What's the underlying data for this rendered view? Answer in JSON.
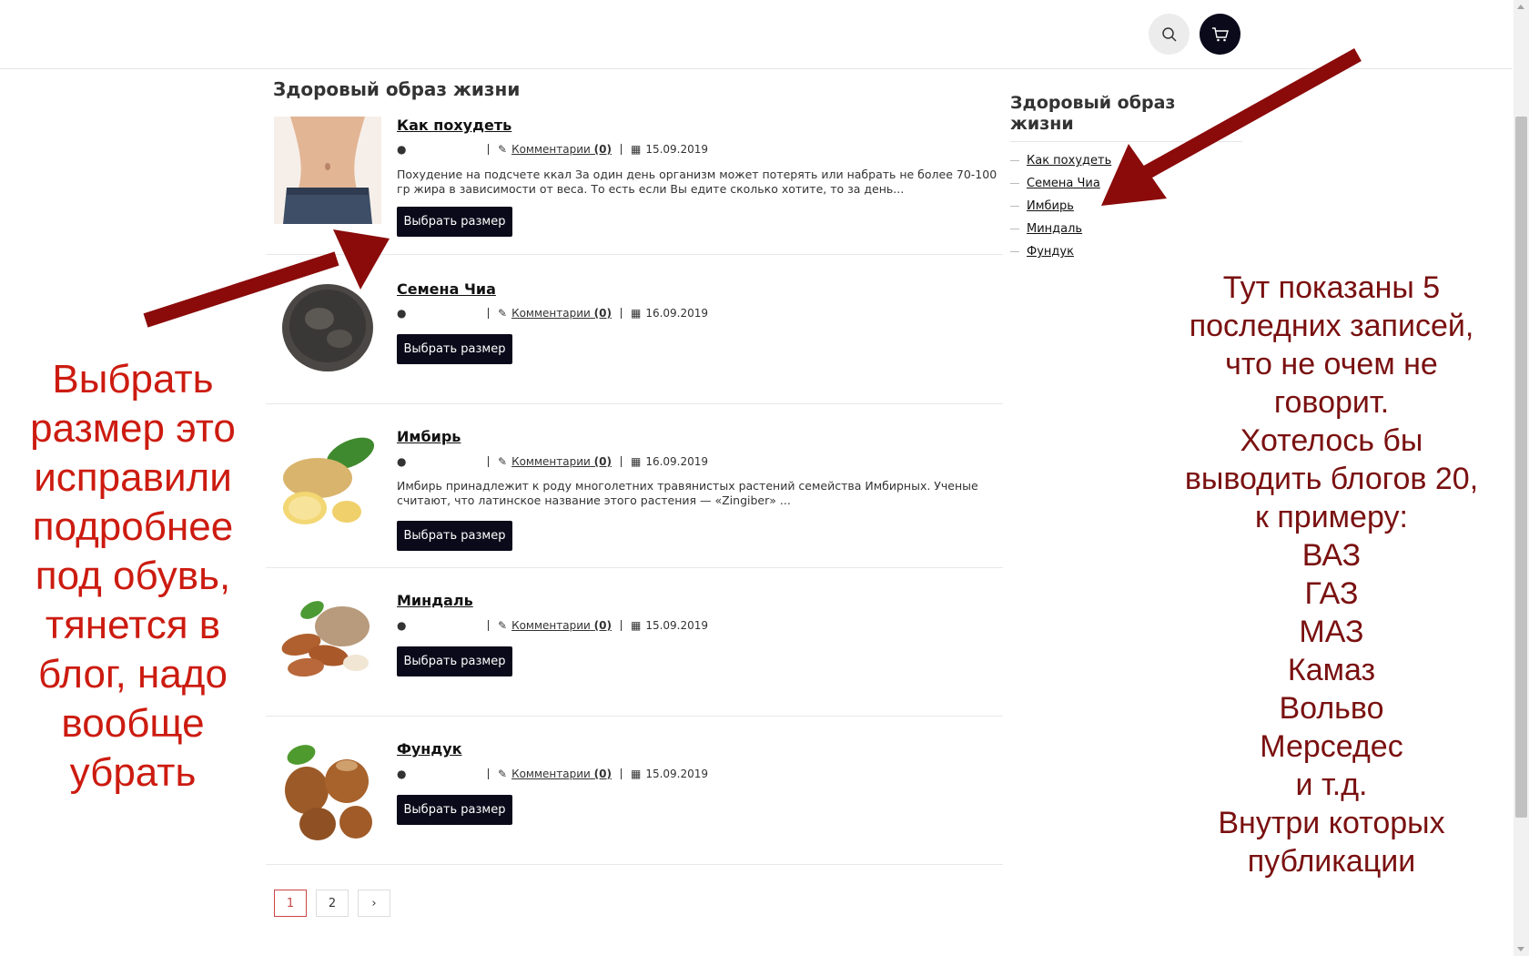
{
  "header": {
    "search_icon": "search-icon",
    "cart_icon": "cart-icon"
  },
  "page_title": "Здоровый образ жизни",
  "posts": [
    {
      "title": "Как похудеть",
      "comments_label": "Комментарии",
      "comments_count": "(0)",
      "date": "15.09.2019",
      "excerpt": "Похудение на подсчете ккал За один день организм может потерять или набрать не более 70-100 гр жира в зависимости от веса. То есть если Вы едите сколько хотите, то за день...",
      "button": "Выбрать размер"
    },
    {
      "title": "Семена Чиа",
      "comments_label": "Комментарии",
      "comments_count": "(0)",
      "date": "16.09.2019",
      "excerpt": "",
      "button": "Выбрать размер"
    },
    {
      "title": "Имбирь",
      "comments_label": "Комментарии",
      "comments_count": "(0)",
      "date": "16.09.2019",
      "excerpt": "Имбирь принадлежит к роду многолетних травянистых растений семейства Имбирных. Ученые считают, что латинское название этого растения — «Zingiber» ...",
      "button": "Выбрать размер"
    },
    {
      "title": "Миндаль",
      "comments_label": "Комментарии",
      "comments_count": "(0)",
      "date": "15.09.2019",
      "excerpt": "",
      "button": "Выбрать размер"
    },
    {
      "title": "Фундук",
      "comments_label": "Комментарии",
      "comments_count": "(0)",
      "date": "15.09.2019",
      "excerpt": "",
      "button": "Выбрать размер"
    }
  ],
  "pagination": {
    "pages": [
      "1",
      "2"
    ],
    "next": "›",
    "active": "1"
  },
  "sidebar": {
    "title": "Здоровый образ жизни",
    "items": [
      "Как похудеть",
      "Семена Чиа",
      "Имбирь",
      "Миндаль",
      "Фундук"
    ]
  },
  "annotations": {
    "left_note": "Выбрать размер это исправили подробнее под обувь, тянется в блог, надо вообще убрать",
    "right_note_lines": [
      "Тут показаны 5",
      "последних записей,",
      "что не очем не",
      "говорит.",
      "Хотелось бы",
      "выводить блогов 20,",
      "к примеру:",
      "ВАЗ",
      "ГАЗ",
      "МАЗ",
      "Камаз",
      "Вольво",
      "Мерседес",
      "и т.д.",
      "Внутри которых",
      "публикации"
    ],
    "color_left": "#cc1b10",
    "color_right": "#7a1010",
    "arrow_color": "#8b0a0a"
  }
}
